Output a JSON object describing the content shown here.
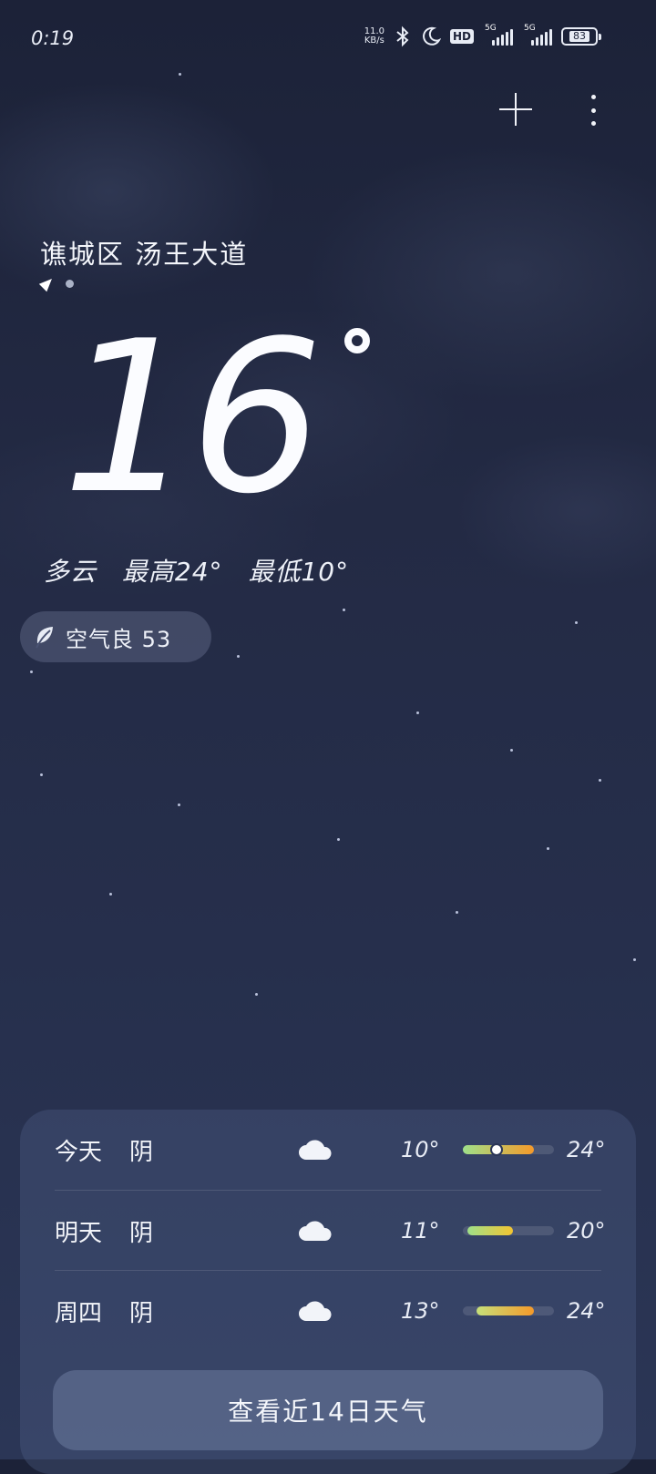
{
  "status_bar": {
    "time": "0:19",
    "net_speed": "11.0",
    "net_unit": "KB/s",
    "hd_label": "HD",
    "sim1_label": "5G",
    "sim2_label": "5G",
    "battery": "83"
  },
  "header": {
    "location": "谯城区 汤王大道"
  },
  "current": {
    "temperature": "16",
    "condition": "多云",
    "high_label": "最高24°",
    "low_label": "最低10°"
  },
  "aqi": {
    "label": "空气良 53"
  },
  "forecast": {
    "rows": [
      {
        "day": "今天",
        "condition": "阴",
        "low": "10°",
        "high": "24°",
        "range_start": 0.0,
        "range_end": 0.78,
        "now_pos": 0.35,
        "gradient": [
          "#9fe08a",
          "#f59a2a"
        ]
      },
      {
        "day": "明天",
        "condition": "阴",
        "low": "11°",
        "high": "20°",
        "range_start": 0.05,
        "range_end": 0.55,
        "now_pos": null,
        "gradient": [
          "#9fe08a",
          "#f3c531"
        ]
      },
      {
        "day": "周四",
        "condition": "阴",
        "low": "13°",
        "high": "24°",
        "range_start": 0.15,
        "range_end": 0.78,
        "now_pos": null,
        "gradient": [
          "#c6e07a",
          "#f59a2a"
        ]
      }
    ],
    "button_label": "查看近14日天气"
  },
  "icons": {
    "add": "plus-icon",
    "more": "more-vertical-icon",
    "aqi": "leaf-icon",
    "weather": "cloud-icon",
    "location": "location-arrow-icon"
  }
}
